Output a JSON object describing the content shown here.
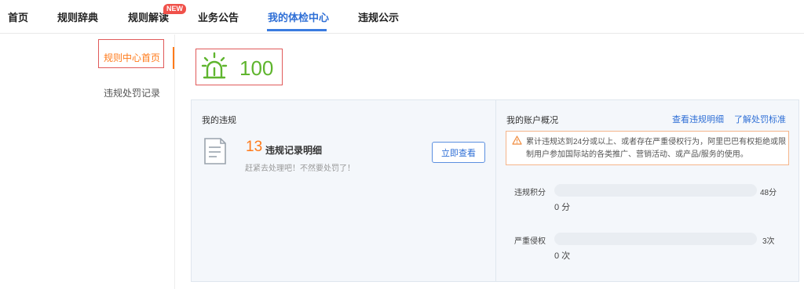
{
  "nav": {
    "items": [
      {
        "label": "首页"
      },
      {
        "label": "规则辞典"
      },
      {
        "label": "规则解读"
      },
      {
        "label": "业务公告"
      },
      {
        "label": "我的体检中心"
      },
      {
        "label": "违规公示"
      }
    ],
    "new_badge": "NEW",
    "active_index": 4
  },
  "sidebar": {
    "items": [
      {
        "label": "规则中心首页"
      },
      {
        "label": "违规处罚记录"
      }
    ],
    "active_index": 0
  },
  "score": {
    "value": "100",
    "icon": "alarm-light-icon",
    "color": "#5fb52e"
  },
  "violations": {
    "title": "我的违规",
    "count": "13",
    "label": "违规记录明细",
    "subtitle": "赶紧去处理吧！不然要处罚了！",
    "button": "立即查看",
    "icon": "document-icon"
  },
  "account": {
    "title": "我的账户概况",
    "links": [
      "查看违规明细",
      "了解处罚标准"
    ],
    "warning": "累计违规达到24分或以上、或者存在严重侵权行为，阿里巴巴有权拒绝或限制用户参加国际站的各类推广、营销活动、或产品/服务的使用。",
    "metrics": [
      {
        "label": "违规积分",
        "max": "48分",
        "value": "0 分",
        "progress": 0
      },
      {
        "label": "严重侵权",
        "max": "3次",
        "value": "0 次",
        "progress": 0
      }
    ]
  },
  "colors": {
    "accent": "#2f6fd6",
    "orange": "#ff7a1a",
    "warning_border": "#f5b58a"
  }
}
